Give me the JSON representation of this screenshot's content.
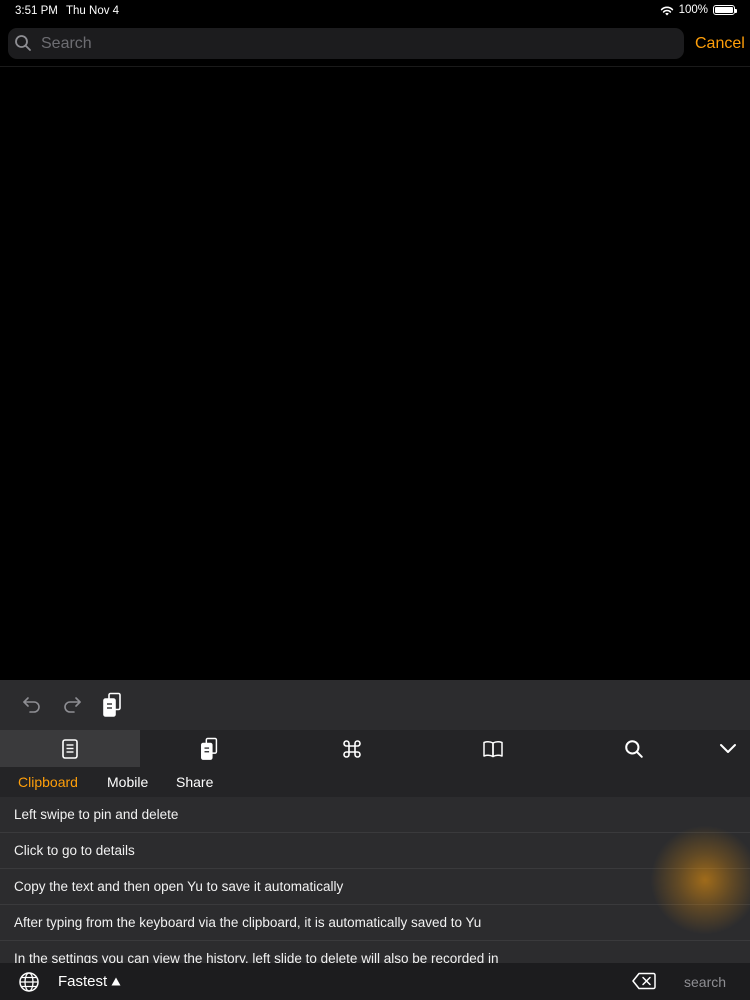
{
  "status": {
    "time": "3:51 PM",
    "date": "Thu Nov 4",
    "battery": "100%",
    "battery_level": 1.0
  },
  "search": {
    "placeholder": "Search",
    "value": "",
    "cancel_label": "Cancel"
  },
  "keyboard": {
    "toolbar_icons": [
      "undo-icon",
      "redo-icon",
      "clipboard-paste-icon"
    ],
    "tabs": [
      {
        "icon": "document-icon",
        "active": true
      },
      {
        "icon": "mobile-clipboard-icon",
        "active": false
      },
      {
        "icon": "command-icon",
        "active": false
      },
      {
        "icon": "book-icon",
        "active": false
      },
      {
        "icon": "search-icon",
        "active": false
      },
      {
        "icon": "chevron-down-icon",
        "active": false
      }
    ],
    "subtabs": [
      {
        "label": "Clipboard",
        "active": true
      },
      {
        "label": "Mobile",
        "active": false
      },
      {
        "label": "Share",
        "active": false
      }
    ],
    "clip_items": [
      "Left swipe to pin and delete",
      "Click to go to details",
      "Copy the text and then open Yu to save it automatically",
      "After typing from the keyboard via the clipboard, it is automatically saved to Yu",
      "In the settings you can view the history, left slide to delete will also be recorded in"
    ],
    "bottom": {
      "speed_label": "Fastest",
      "search_label": "search"
    }
  },
  "colors": {
    "accent": "#ff9f0a",
    "background": "#000000",
    "keyboard_bg": "#2c2c2e"
  }
}
